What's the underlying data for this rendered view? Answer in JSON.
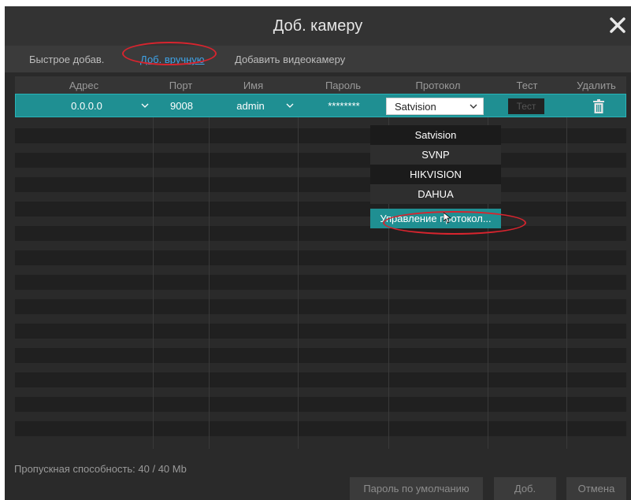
{
  "dialog": {
    "title": "Доб. камеру"
  },
  "tabs": [
    "Быстрое добав.",
    "Доб. вручную",
    "Добавить видеокамеру"
  ],
  "active_tab": "Доб. вручную",
  "table": {
    "headers": [
      "Адрес",
      "Порт",
      "Имя",
      "Пароль",
      "Протокол",
      "Тест",
      "Удалить"
    ],
    "row": {
      "address": "0.0.0.0",
      "port": "9008",
      "name": "admin",
      "password": "********",
      "protocol": "Satvision",
      "test_label": "Тест"
    }
  },
  "protocol_dropdown": {
    "options": [
      "Satvision",
      "SVNP",
      "HIKVISION",
      "DAHUA",
      "Управление протокол..."
    ],
    "highlighted": "Управление протокол..."
  },
  "footer": {
    "bandwidth": "Пропускная способность: 40 / 40 Mb",
    "buttons": [
      "Пароль по умолчанию",
      "Доб.",
      "Отмена"
    ]
  },
  "colors": {
    "accent_teal": "#1f8f92",
    "link_blue": "#3fa3e8",
    "annotation_red": "#d8242e"
  },
  "icons": [
    "close-icon",
    "chevron-down-icon",
    "trash-icon",
    "cursor-icon"
  ]
}
